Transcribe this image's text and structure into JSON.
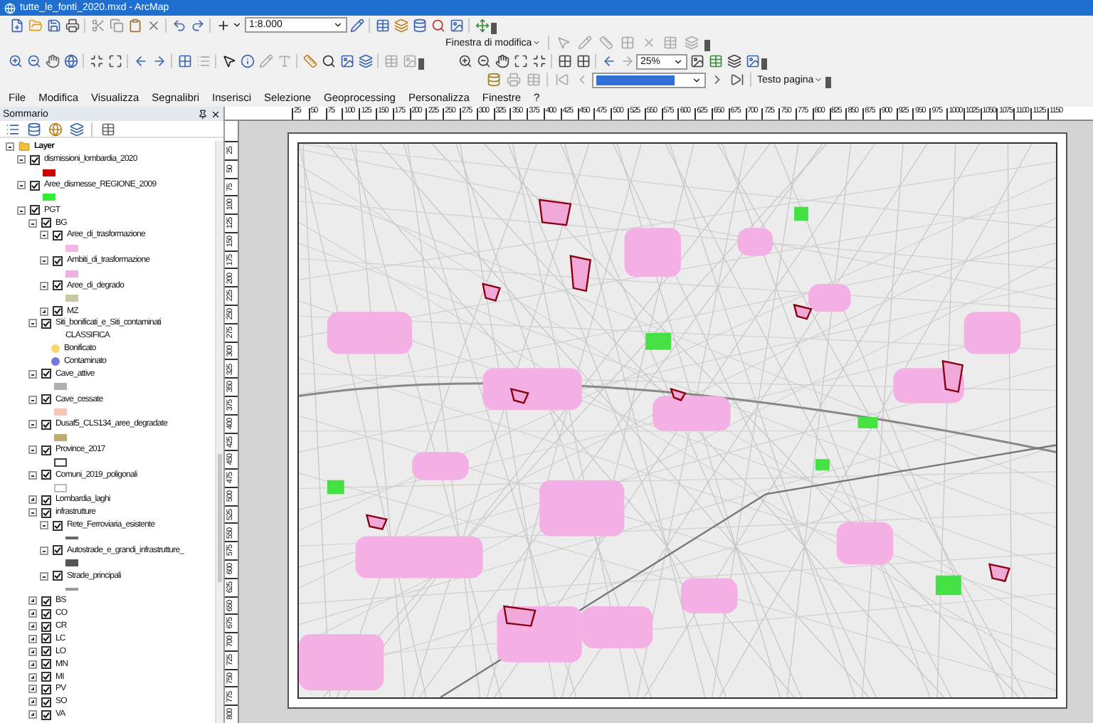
{
  "window": {
    "title": "tutte_le_fonti_2020.mxd - ArcMap"
  },
  "toolbar": {
    "scale": "1:8.000",
    "edit_menu": "Finestra di modifica",
    "zoom_percent": "25%",
    "page_text_menu": "Testo pagina"
  },
  "menu": [
    "File",
    "Modifica",
    "Visualizza",
    "Segnalibri",
    "Inserisci",
    "Selezione",
    "Geoprocessing",
    "Personalizza",
    "Finestre",
    "?"
  ],
  "toc": {
    "title": "Sommario",
    "tree": [
      {
        "label": "Layer",
        "kind": "frame",
        "expanded": true,
        "children": [
          {
            "label": "dismissioni_lombardia_2020",
            "kind": "layer",
            "checked": true,
            "expanded": true,
            "legend": [
              {
                "kind": "fill",
                "color": "#cc0000"
              }
            ]
          },
          {
            "label": "Aree_dismesse_REGIONE_2009",
            "kind": "layer",
            "checked": true,
            "expanded": true,
            "legend": [
              {
                "kind": "fill",
                "color": "#33ee33"
              }
            ]
          },
          {
            "label": "PGT",
            "kind": "layer",
            "checked": true,
            "expanded": true,
            "children": [
              {
                "label": "BG",
                "kind": "layer",
                "checked": true,
                "expanded": true,
                "children": [
                  {
                    "label": "Aree_di_trasformazione",
                    "kind": "layer",
                    "checked": true,
                    "expanded": true,
                    "legend": [
                      {
                        "kind": "fill",
                        "color": "#f4b8e8"
                      }
                    ]
                  },
                  {
                    "label": "Ambiti_di_trasformazione",
                    "kind": "layer",
                    "checked": true,
                    "expanded": true,
                    "legend": [
                      {
                        "kind": "fill",
                        "color": "#eeb0e0"
                      }
                    ]
                  },
                  {
                    "label": "Aree_di_degrado",
                    "kind": "layer",
                    "checked": true,
                    "expanded": true,
                    "legend": [
                      {
                        "kind": "fill",
                        "color": "#c8c8a0"
                      }
                    ]
                  },
                  {
                    "label": "MZ",
                    "kind": "layer",
                    "checked": true,
                    "expanded": false
                  }
                ]
              },
              {
                "label": "Siti_bonificati_e_Siti_contaminati",
                "kind": "layer",
                "checked": true,
                "expanded": true,
                "legend": [
                  {
                    "kind": "heading",
                    "label": "CLASSIFICA"
                  },
                  {
                    "kind": "point",
                    "color": "#f5d76e",
                    "label": "Bonificato"
                  },
                  {
                    "kind": "point",
                    "color": "#7777dd",
                    "label": "Contaminato"
                  }
                ]
              },
              {
                "label": "Cave_attive",
                "kind": "layer",
                "checked": true,
                "expanded": true,
                "legend": [
                  {
                    "kind": "fill",
                    "color": "#b0b0b0"
                  }
                ]
              },
              {
                "label": "Cave_cessate",
                "kind": "layer",
                "checked": true,
                "expanded": true,
                "legend": [
                  {
                    "kind": "fill",
                    "color": "#f5c5b5"
                  }
                ]
              },
              {
                "label": "Dusaf5_CLS134_aree_degradate",
                "kind": "layer",
                "checked": true,
                "expanded": true,
                "legend": [
                  {
                    "kind": "fill",
                    "color": "#c0aa70"
                  }
                ]
              },
              {
                "label": "Province_2017",
                "kind": "layer",
                "checked": true,
                "expanded": true,
                "legend": [
                  {
                    "kind": "outline",
                    "color": "#444444"
                  }
                ]
              },
              {
                "label": "Comuni_2019_poligonali",
                "kind": "layer",
                "checked": true,
                "expanded": true,
                "legend": [
                  {
                    "kind": "outline",
                    "color": "#bbbbbb"
                  }
                ]
              },
              {
                "label": "Lombardia_laghi",
                "kind": "layer",
                "checked": true,
                "expanded": false
              },
              {
                "label": "infrastrutture",
                "kind": "layer",
                "checked": true,
                "expanded": true,
                "children": [
                  {
                    "label": "Rete_Ferroviaria_esistente",
                    "kind": "layer",
                    "checked": true,
                    "expanded": true,
                    "legend": [
                      {
                        "kind": "line",
                        "color": "#666666"
                      }
                    ]
                  },
                  {
                    "label": "Autostrade_e_grandi_infrastrutture_",
                    "kind": "layer",
                    "checked": true,
                    "expanded": true,
                    "legend": [
                      {
                        "kind": "fill",
                        "color": "#555555"
                      }
                    ]
                  },
                  {
                    "label": "Strade_principali",
                    "kind": "layer",
                    "checked": true,
                    "expanded": true,
                    "legend": [
                      {
                        "kind": "line",
                        "color": "#999999"
                      }
                    ]
                  }
                ]
              },
              {
                "label": "BS",
                "kind": "layer",
                "checked": true,
                "expanded": false
              },
              {
                "label": "CO",
                "kind": "layer",
                "checked": true,
                "expanded": false
              },
              {
                "label": "CR",
                "kind": "layer",
                "checked": true,
                "expanded": false
              },
              {
                "label": "LC",
                "kind": "layer",
                "checked": true,
                "expanded": false
              },
              {
                "label": "LO",
                "kind": "layer",
                "checked": true,
                "expanded": false
              },
              {
                "label": "MN",
                "kind": "layer",
                "checked": true,
                "expanded": false
              },
              {
                "label": "MI",
                "kind": "layer",
                "checked": true,
                "expanded": false
              },
              {
                "label": "PV",
                "kind": "layer",
                "checked": true,
                "expanded": false
              },
              {
                "label": "SO",
                "kind": "layer",
                "checked": true,
                "expanded": false
              },
              {
                "label": "VA",
                "kind": "layer",
                "checked": true,
                "expanded": false
              }
            ]
          }
        ]
      }
    ]
  },
  "ruler": {
    "horizontal": [
      "25",
      "50",
      "75",
      "100",
      "125",
      "150",
      "175",
      "200",
      "225",
      "250",
      "275",
      "300",
      "325",
      "350",
      "375",
      "400",
      "425",
      "450",
      "475",
      "500",
      "525",
      "550",
      "575",
      "600",
      "625",
      "650",
      "675",
      "700",
      "725",
      "750",
      "775",
      "800",
      "825",
      "850",
      "875",
      "900",
      "925",
      "950",
      "975",
      "1000",
      "1025",
      "1050",
      "1075",
      "1100",
      "1125",
      "1150"
    ],
    "vertical": [
      "25",
      "50",
      "75",
      "100",
      "125",
      "150",
      "175",
      "200",
      "225",
      "250",
      "275",
      "300",
      "325",
      "350",
      "375",
      "400",
      "425",
      "450",
      "475",
      "500",
      "525",
      "550",
      "575",
      "600",
      "625",
      "650",
      "675",
      "700",
      "725",
      "750",
      "775",
      "800"
    ]
  }
}
